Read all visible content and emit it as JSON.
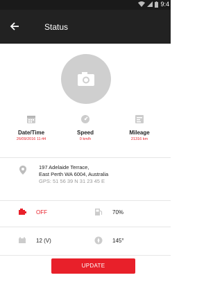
{
  "status_bar": {
    "time": "9:4",
    "icons": [
      "wifi-icon",
      "signal-icon",
      "battery-icon"
    ]
  },
  "app_bar": {
    "title": "Status",
    "back_icon": "arrow-left-icon"
  },
  "photo": {
    "icon": "camera-icon"
  },
  "stats": [
    {
      "icon": "calendar-icon",
      "label": "Date/Time",
      "value": "26/09/2016 11:44"
    },
    {
      "icon": "speedometer-icon",
      "label": "Speed",
      "value": "0 km/h"
    },
    {
      "icon": "odometer-icon",
      "label": "Mileage",
      "value": "21316 km"
    }
  ],
  "address": {
    "icon": "location-pin-icon",
    "line1": "197 Adelaide Terrace,",
    "line2": "East Perth WA 6004, Australia",
    "gps": "GPS: 51 56 39 N 31 23 45 E"
  },
  "details": [
    {
      "icon": "engine-icon",
      "value": "OFF"
    },
    {
      "icon": "fuel-icon",
      "value": "70%"
    },
    {
      "icon": "battery-voltage-icon",
      "value": "12 (V)"
    },
    {
      "icon": "compass-icon",
      "value": "145°"
    }
  ],
  "actions": {
    "update_label": "UPDATE"
  },
  "colors": {
    "accent": "#e8202a",
    "appbar": "#222222",
    "statusbar": "#1a1a1a"
  }
}
